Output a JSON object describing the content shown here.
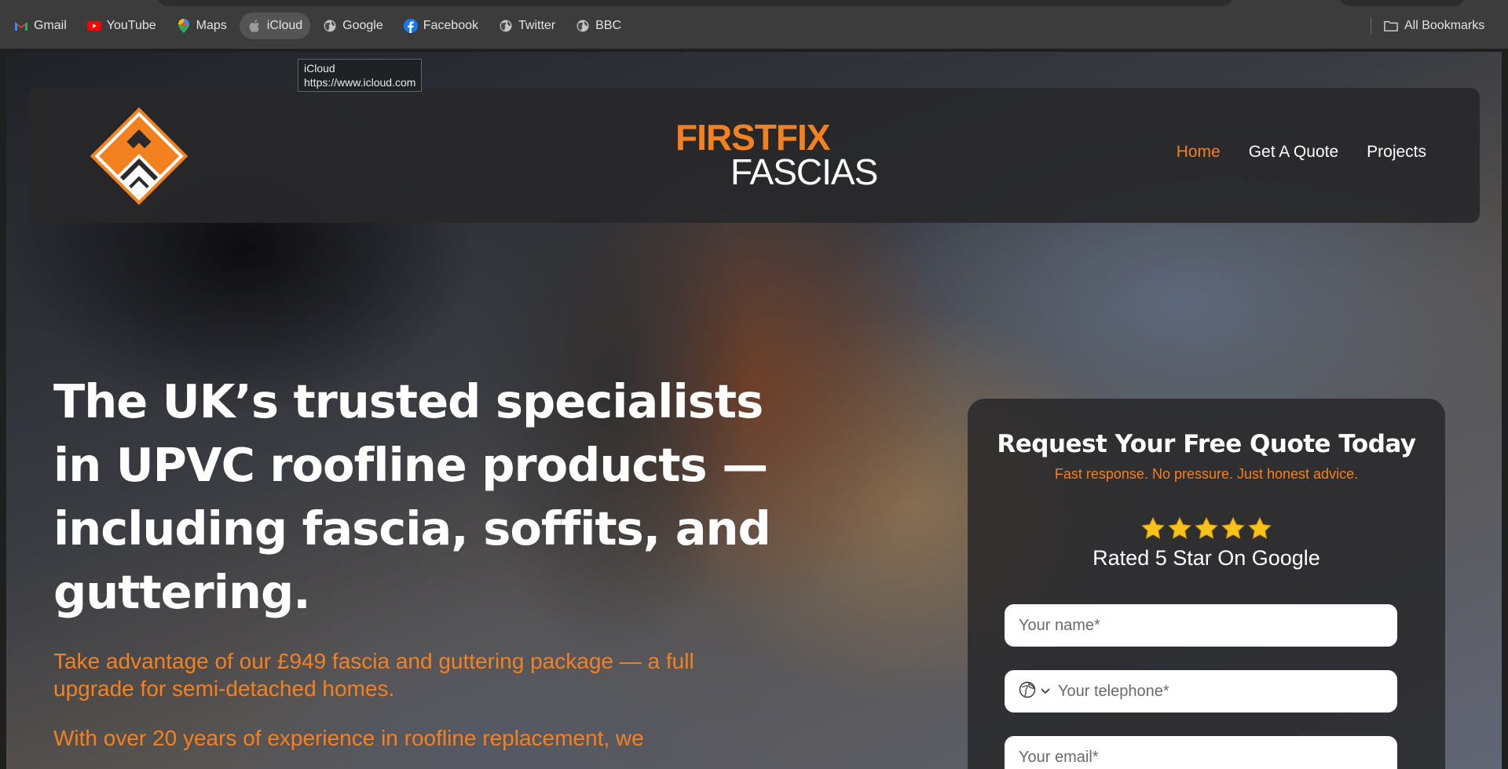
{
  "browser": {
    "bookmarks": [
      {
        "label": "Gmail",
        "icon": "gmail-icon"
      },
      {
        "label": "YouTube",
        "icon": "youtube-icon"
      },
      {
        "label": "Maps",
        "icon": "maps-icon"
      },
      {
        "label": "iCloud",
        "icon": "apple-icon"
      },
      {
        "label": "Google",
        "icon": "globe-icon"
      },
      {
        "label": "Facebook",
        "icon": "facebook-icon"
      },
      {
        "label": "Twitter",
        "icon": "globe-icon"
      },
      {
        "label": "BBC",
        "icon": "globe-icon"
      }
    ],
    "all_bookmarks_label": "All Bookmarks",
    "tooltip": {
      "title": "iCloud",
      "url": "https://www.icloud.com"
    }
  },
  "site": {
    "brand_top": "FIRSTFIX",
    "brand_bottom": "FASCIAS",
    "nav": [
      {
        "label": "Home",
        "active": true
      },
      {
        "label": "Get A Quote",
        "active": false
      },
      {
        "label": "Projects",
        "active": false
      }
    ],
    "accent": "#f48120"
  },
  "hero": {
    "heading": "The UK’s trusted specialists in UPVC roofline products — including fascia, soffits, and guttering.",
    "paragraph1": "Take advantage of our £949 fascia and guttering package — a full upgrade for semi-detached homes.",
    "paragraph2": "With over 20 years of experience in roofline replacement, we"
  },
  "quote_form": {
    "title": "Request Your Free Quote Today",
    "subtitle": "Fast response. No pressure. Just honest advice.",
    "rating_stars": 5,
    "rating_text": "Rated  5 Star On Google",
    "name_placeholder": "Your name*",
    "tel_placeholder": "Your telephone*",
    "email_placeholder": "Your email*"
  }
}
